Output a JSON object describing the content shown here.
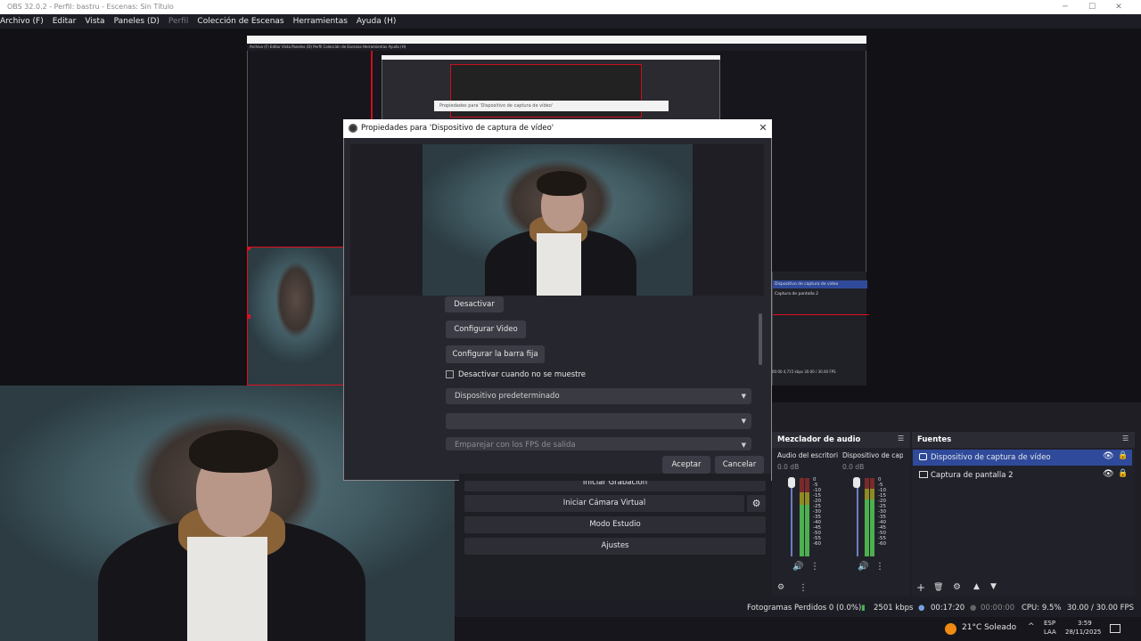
{
  "window": {
    "title": "OBS 32.0.2 - Perfil: bastru - Escenas: Sin Título"
  },
  "menu": [
    {
      "label": "Archivo (F)",
      "dim": false
    },
    {
      "label": "Editar",
      "dim": false
    },
    {
      "label": "Vista",
      "dim": false
    },
    {
      "label": "Paneles (D)",
      "dim": false
    },
    {
      "label": "Perfil",
      "dim": true
    },
    {
      "label": "Colección de Escenas",
      "dim": false
    },
    {
      "label": "Herramientas",
      "dim": false
    },
    {
      "label": "Ayuda (H)",
      "dim": false
    }
  ],
  "nested": {
    "menu_text": "Archivo (F)   Editar   Vista   Paneles (D)   Perfil   Colección de Escenas   Herramientas   Ayuda (H)",
    "dialog_title": "Propiedades para 'Dispositivo de captura de vídeo'",
    "sources": [
      "Dispositivo de captura de vídeo",
      "Captura de pantalla 2"
    ],
    "status": "00:00   4,715 kbps   30.00 / 30.00 FPS"
  },
  "dialog": {
    "title": "Propiedades para 'Dispositivo de captura de vídeo'",
    "buttons": {
      "deactivate": "Desactivar",
      "configure_video": "Configurar Video",
      "configure_crossbar": "Configurar la barra fija"
    },
    "checkbox_label": "Desactivar cuando no se muestre",
    "combos": {
      "device": "Dispositivo predeterminado",
      "blank": "",
      "fps": "Emparejar con los FPS de salida"
    },
    "ok": "Aceptar",
    "cancel": "Cancelar"
  },
  "controls": {
    "start_recording": "Iniciar Grabación",
    "virtual_camera": "Iniciar Cámara Virtual",
    "studio_mode": "Modo Estudio",
    "settings": "Ajustes"
  },
  "mixer": {
    "title": "Mezclador de audio",
    "channels": [
      {
        "name": "Audio del escritorio",
        "db": "0.0 dB"
      },
      {
        "name": "Dispositivo de captura",
        "db": "0.0 dB"
      }
    ],
    "scale": [
      "0",
      "-5",
      "-10",
      "-15",
      "-20",
      "-25",
      "-30",
      "-35",
      "-40",
      "-45",
      "-50",
      "-55",
      "-60"
    ]
  },
  "sources": {
    "title": "Fuentes",
    "items": [
      {
        "label": "Dispositivo de captura de vídeo",
        "selected": true,
        "icon": "camera-icon"
      },
      {
        "label": "Captura de pantalla 2",
        "selected": false,
        "icon": "monitor-icon"
      }
    ]
  },
  "status": {
    "dropped": "Fotogramas Perdidos 0 (0.0%)",
    "bitrate": "2501 kbps",
    "stream_time": "00:17:20",
    "rec_time": "00:00:00",
    "cpu": "CPU: 9.5%",
    "fps": "30.00 / 30.00 FPS"
  },
  "taskbar": {
    "weather": "21°C  Soleado",
    "lang_1": "ESP",
    "lang_2": "LAA",
    "time": "3:59",
    "date": "28/11/2025"
  },
  "colors": {
    "accent": "#2f4a9a",
    "record_red": "#e01020",
    "meter_green": "#4caf50"
  }
}
